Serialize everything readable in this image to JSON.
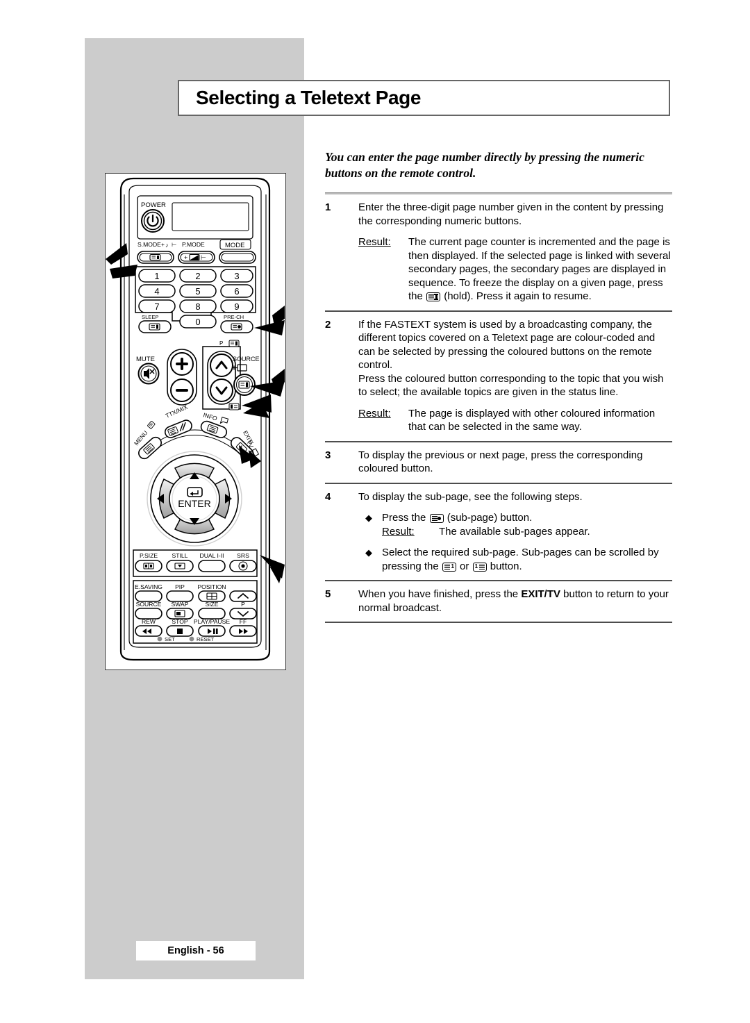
{
  "page": {
    "title": "Selecting a Teletext Page",
    "footer_label": "English - 56",
    "intro": "You can enter the page number directly by pressing the numeric buttons on the remote control.",
    "result_label": "Result:",
    "bullet_glyph": "◆"
  },
  "steps": [
    {
      "num": "1",
      "text": "Enter the three-digit page number given in the content by pressing the corresponding numeric buttons.",
      "result_pre": "The current page counter is incremented and the page is then displayed. If the selected page is linked with several secondary pages, the secondary pages are displayed in sequence. To freeze the display on a given page, press the ",
      "result_post": " (hold). Press it again to resume."
    },
    {
      "num": "2",
      "text": "If the FASTEXT system is used by a broadcasting company, the different topics covered on a Teletext page are colour-coded and can be selected by pressing the coloured buttons on the remote control.",
      "text2": "Press the coloured button corresponding to the topic that you wish to select; the available topics are given in the status line.",
      "result": "The page is displayed with other coloured information that can be selected in the same way."
    },
    {
      "num": "3",
      "text": "To display the previous or next page, press the corresponding coloured button."
    },
    {
      "num": "4",
      "text": "To display the sub-page, see the following steps.",
      "bullet1_pre": "Press the ",
      "bullet1_post": " (sub-page) button.",
      "bullet1_result": "The available sub-pages appear.",
      "bullet2_pre": "Select the required sub-page. Sub-pages can be scrolled by pressing the ",
      "bullet2_mid": " or ",
      "bullet2_post": " button."
    },
    {
      "num": "5",
      "text_pre": "When you have finished, press the ",
      "text_bold": "EXIT/TV",
      "text_post": " button to return to your normal broadcast."
    }
  ],
  "remote": {
    "power_label": "POWER",
    "row_smode": "S.MODE",
    "row_pmode": "P.MODE",
    "row_mode": "MODE",
    "keys": [
      "1",
      "2",
      "3",
      "4",
      "5",
      "6",
      "7",
      "8",
      "9",
      "0"
    ],
    "sleep": "SLEEP",
    "prech": "PRE-CH",
    "mute": "MUTE",
    "source": "SOURCE",
    "p_label": "P",
    "menu": "MENU",
    "ttxmix": "TTX/MIX",
    "info": "INFO",
    "exittv": "EXIT/ TV",
    "enter": "ENTER",
    "bottom_row1": [
      "P.SIZE",
      "STILL",
      "DUAL I-II",
      "SRS"
    ],
    "bottom_row2": [
      "E.SAVING",
      "PIP",
      "POSITION"
    ],
    "bottom_row3": [
      "SOURCE",
      "SWAP",
      "SIZE",
      "P"
    ],
    "bottom_row4": [
      "REW",
      "STOP",
      "PLAY/PAUSE",
      "FF"
    ],
    "set": "SET",
    "reset": "RESET"
  },
  "colors": {
    "panel_grey": "#cccccc",
    "frame_grey": "#666666",
    "rule_grey": "#8a8a8a",
    "text_black": "#000000"
  }
}
